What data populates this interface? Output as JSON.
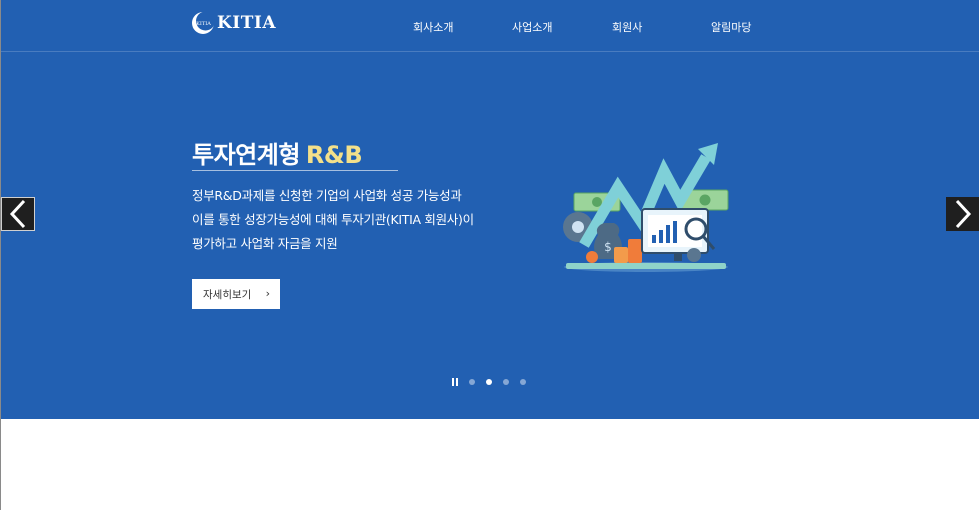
{
  "header": {
    "logo_text": "KITIA",
    "logo_mark_text": "KITIA",
    "nav": [
      "회사소개",
      "사업소개",
      "회원사",
      "알림마당"
    ]
  },
  "hero": {
    "title_main": "투자연계형",
    "title_accent": "R&B",
    "description": [
      "정부R&D과제를 신청한 기업의 사업화 성공 가능성과",
      "이를 통한 성장가능성에 대해 투자기관(KITIA 회원사)이",
      "평가하고 사업화 자금을 지원"
    ],
    "button_label": "자세히보기",
    "button_icon": "chevron-right-icon",
    "prev_icon": "chevron-left-icon",
    "next_icon": "chevron-right-icon"
  },
  "pager": {
    "slide_count": 4,
    "active_index": 1,
    "pause_icon": "pause-icon"
  },
  "colors": {
    "hero_bg": "#2260b2",
    "accent": "#f3e08a",
    "arrow_bg": "#1f1f1f"
  }
}
